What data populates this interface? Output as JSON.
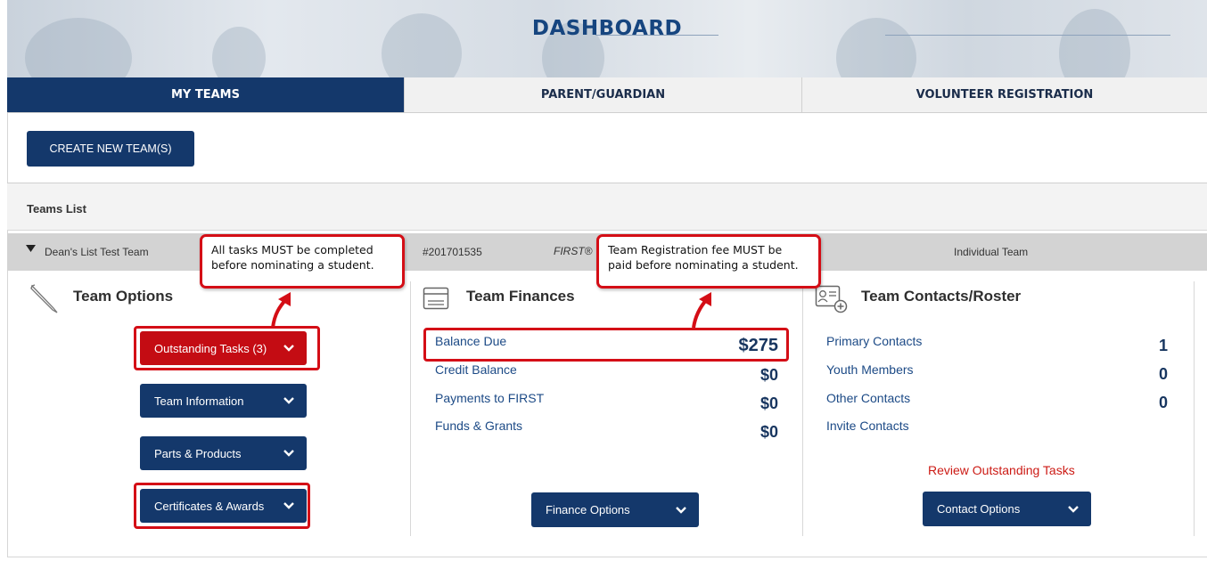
{
  "header": {
    "title": "DASHBOARD"
  },
  "tabs": [
    {
      "label": "MY TEAMS"
    },
    {
      "label": "PARENT/GUARDIAN"
    },
    {
      "label": "VOLUNTEER REGISTRATION"
    }
  ],
  "create_button": "CREATE NEW TEAM(S)",
  "teams_list": {
    "label": "Teams List",
    "team": {
      "name": "Dean's List Test Team",
      "number": "#201701535",
      "program": "FIRST®",
      "type": "Individual Team"
    }
  },
  "team_options": {
    "title": "Team Options",
    "buttons": [
      {
        "label": "Outstanding Tasks (3)"
      },
      {
        "label": "Team Information"
      },
      {
        "label": "Parts & Products"
      },
      {
        "label": "Certificates & Awards"
      }
    ]
  },
  "team_finances": {
    "title": "Team Finances",
    "rows": [
      {
        "label": "Balance Due",
        "value": "$275"
      },
      {
        "label": "Credit Balance",
        "value": "$0"
      },
      {
        "label": "Payments to FIRST",
        "value": "$0"
      },
      {
        "label": "Funds & Grants",
        "value": "$0"
      }
    ],
    "button": "Finance Options"
  },
  "team_contacts": {
    "title": "Team Contacts/Roster",
    "rows": [
      {
        "label": "Primary Contacts",
        "value": "1"
      },
      {
        "label": "Youth Members",
        "value": "0"
      },
      {
        "label": "Other Contacts",
        "value": "0"
      },
      {
        "label": "Invite Contacts",
        "value": ""
      }
    ],
    "review_link": "Review Outstanding Tasks",
    "button": "Contact Options"
  },
  "callouts": {
    "tasks_line1": "All tasks MUST be completed",
    "tasks_line2": "before nominating a student.",
    "fee_line1": "Team Registration fee MUST be",
    "fee_line2": "paid before nominating a student."
  },
  "colors": {
    "navy": "#14386b",
    "alert_red": "#d40e16"
  }
}
